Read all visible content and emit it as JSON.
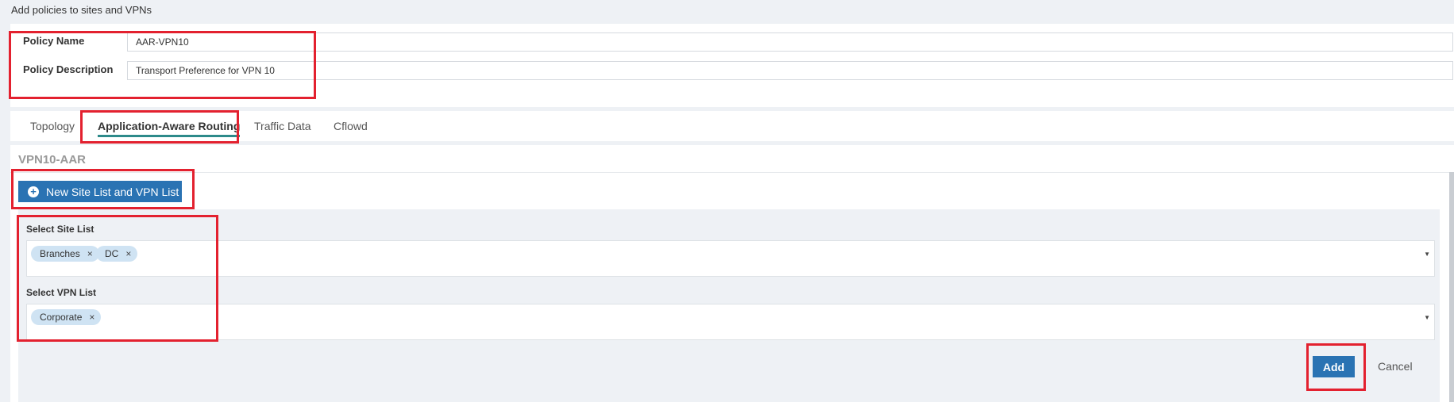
{
  "page": {
    "heading": "Add policies to sites and VPNs"
  },
  "policy": {
    "name_label": "Policy Name",
    "name_value": "AAR-VPN10",
    "description_label": "Policy Description",
    "description_value": "Transport Preference for VPN 10"
  },
  "tabs": [
    {
      "label": "Topology",
      "active": false
    },
    {
      "label": "Application-Aware Routing",
      "active": true
    },
    {
      "label": "Traffic Data",
      "active": false
    },
    {
      "label": "Cflowd",
      "active": false
    }
  ],
  "section": {
    "title": "VPN10-AAR",
    "new_list_button": "New Site List and VPN List"
  },
  "site_list": {
    "label": "Select Site List",
    "chips": [
      "Branches",
      "DC"
    ]
  },
  "vpn_list": {
    "label": "Select VPN List",
    "chips": [
      "Corporate"
    ]
  },
  "actions": {
    "add": "Add",
    "cancel": "Cancel"
  },
  "icons": {
    "plus": "plus-circle-icon",
    "remove": "close-icon",
    "dropdown": "caret-down-icon"
  },
  "colors": {
    "primary": "#2a73b3",
    "tab_underline": "#2d8a8a",
    "chip": "#cfe3f3",
    "highlight": "#e3212f"
  }
}
